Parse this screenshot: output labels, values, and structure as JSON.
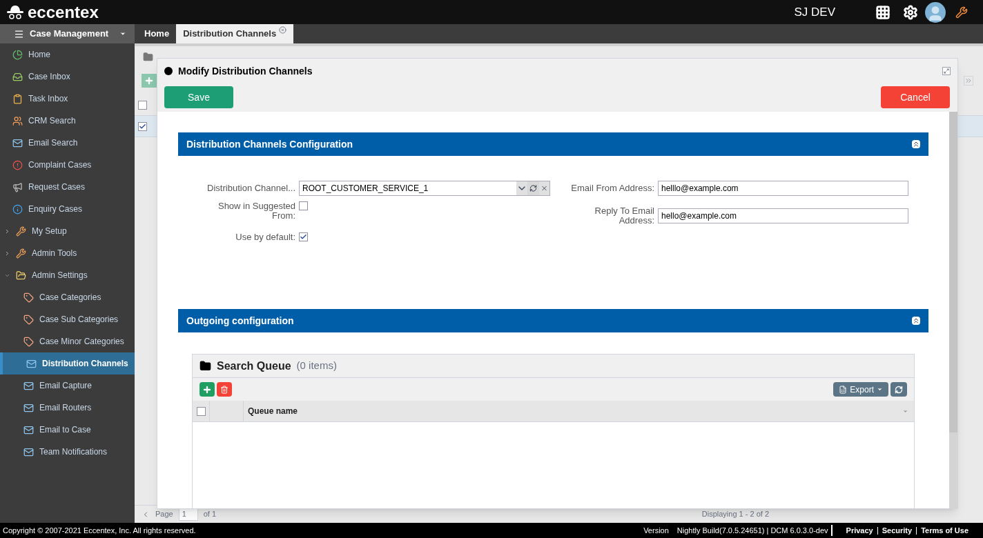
{
  "topbar": {
    "logo": "eccentex",
    "user": "SJ DEV"
  },
  "sidebar": {
    "title": "Case Management",
    "items": [
      {
        "label": "Home",
        "selected": false
      },
      {
        "label": "Case Inbox",
        "selected": false
      },
      {
        "label": "Task Inbox",
        "selected": false
      },
      {
        "label": "CRM Search",
        "selected": false
      },
      {
        "label": "Email Search",
        "selected": false
      },
      {
        "label": "Complaint Cases",
        "selected": false
      },
      {
        "label": "Request Cases",
        "selected": false
      },
      {
        "label": "Enquiry Cases",
        "selected": false
      },
      {
        "label": "My Setup",
        "expanded": false,
        "selected": false
      },
      {
        "label": "Admin Tools",
        "expanded": false,
        "selected": false
      },
      {
        "label": "Admin Settings",
        "expanded": true,
        "selected": false,
        "children": [
          {
            "label": "Case Categories",
            "selected": false
          },
          {
            "label": "Case Sub Categories",
            "selected": false
          },
          {
            "label": "Case Minor Categories",
            "selected": false
          },
          {
            "label": "Distribution Channels",
            "selected": true
          },
          {
            "label": "Email Capture",
            "selected": false
          },
          {
            "label": "Email Routers",
            "selected": false
          },
          {
            "label": "Email to Case",
            "selected": false
          },
          {
            "label": "Team Notifications",
            "selected": false
          }
        ]
      }
    ]
  },
  "tabs": [
    {
      "label": "Home",
      "selected": false
    },
    {
      "label": "Distribution Channels",
      "selected": true
    }
  ],
  "background_page": {
    "rows": [
      {
        "checked": false
      },
      {
        "checked": true
      }
    ],
    "pager": {
      "page_label": "Page",
      "page": "1",
      "of": "of 1",
      "displaying": "Displaying 1 - 2 of 2"
    }
  },
  "modal": {
    "title": "Modify Distribution Channels",
    "save": "Save",
    "cancel": "Cancel",
    "sections": [
      {
        "title": "Distribution Channels Configuration"
      },
      {
        "title": "Outgoing configuration"
      }
    ],
    "form": {
      "channel_label": "Distribution Channel...",
      "channel_value": "ROOT_CUSTOMER_SERVICE_1",
      "suggested_label": "Show in Suggested From:",
      "suggested_checked": false,
      "default_label": "Use by default:",
      "default_checked": true,
      "from_label": "Email From Address:",
      "from_value": "helllo@example.com",
      "reply_label": "Reply To Email Address:",
      "reply_value": "hello@example.com"
    },
    "grid": {
      "title": "Search Queue",
      "count": "(0 items)",
      "export": "Export",
      "columns": [
        "Queue name"
      ],
      "header_checked": false
    }
  },
  "footer": {
    "copyright": "Copyright © 2007-2021 Eccentex, Inc. All rights reserved.",
    "version_label": "Version",
    "version": "Nightly Build(7.0.5.24651) | DCM 6.0.3.0-dev",
    "links": [
      "Privacy",
      "Security",
      "Terms of Use"
    ]
  }
}
